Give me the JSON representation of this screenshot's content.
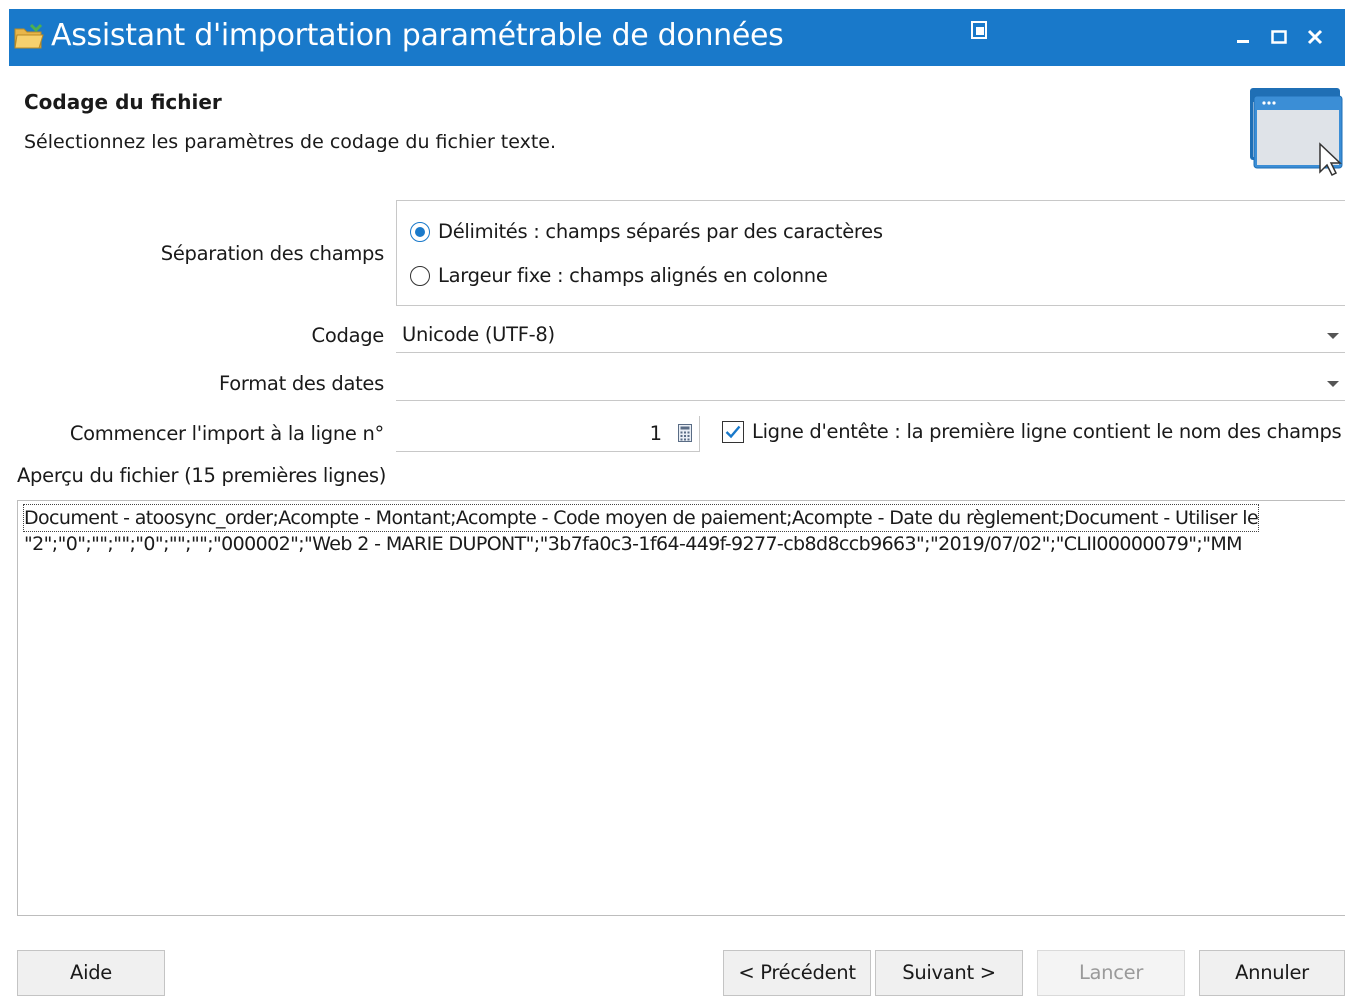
{
  "window": {
    "title": "Assistant d'importation paramétrable de données",
    "icons": [
      "folder-open-icon",
      "window-switch-icon",
      "minimize-icon",
      "maximize-icon",
      "close-icon"
    ],
    "accent_color": "#1979ca"
  },
  "header": {
    "title": "Codage du fichier",
    "subtitle": "Sélectionnez les paramètres de codage du fichier texte."
  },
  "form": {
    "separation": {
      "label": "Séparation des champs",
      "options": [
        {
          "label": "Délimités : champs séparés par des caractères",
          "selected": true
        },
        {
          "label": "Largeur fixe : champs alignés en colonne",
          "selected": false
        }
      ]
    },
    "encoding": {
      "label": "Codage",
      "value": "Unicode (UTF-8)"
    },
    "date_format": {
      "label": "Format des dates",
      "value": ""
    },
    "start_line": {
      "label": "Commencer l'import à la ligne n°",
      "value": "1"
    },
    "header_line": {
      "label": "Ligne d'entête : la première ligne contient le nom des champs",
      "checked": true
    }
  },
  "preview": {
    "label": "Aperçu du fichier (15 premières lignes)",
    "lines": [
      "Document - atoosync_order;Acompte - Montant;Acompte - Code moyen de paiement;Acompte - Date du règlement;Document - Utiliser le",
      "\"2\";\"0\";\"\";\"\";\"0\";\"\";\"\";\"000002\";\"Web 2 - MARIE DUPONT\";\"3b7fa0c3-1f64-449f-9277-cb8d8ccb9663\";\"2019/07/02\";\"CLII00000079\";\"MM"
    ]
  },
  "buttons": {
    "help": "Aide",
    "previous": "< Précédent",
    "next": "Suivant >",
    "run": "Lancer",
    "cancel": "Annuler"
  }
}
